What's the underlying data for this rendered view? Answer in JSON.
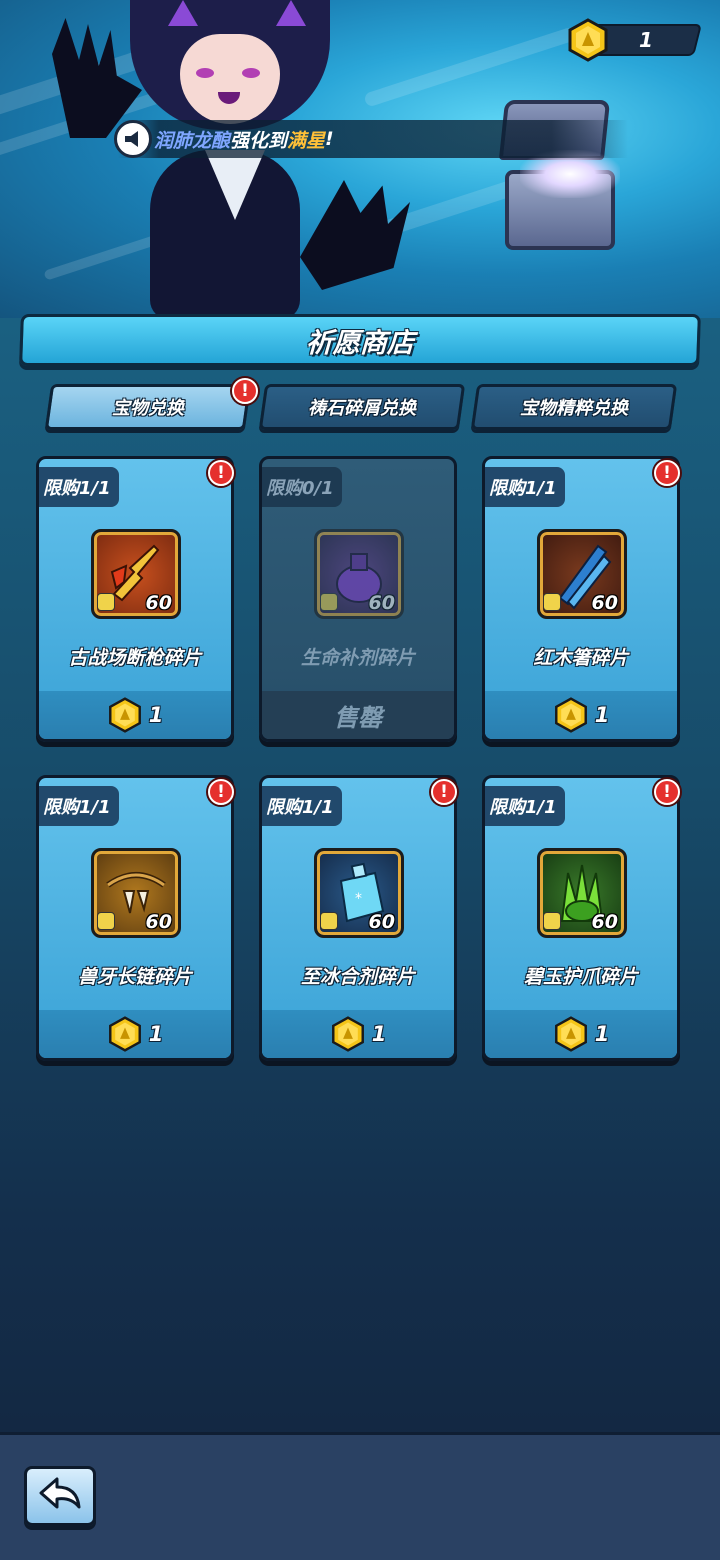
{
  "currency": {
    "amount": "1",
    "icon": "dice-coin-icon"
  },
  "announcement": {
    "part1": "润肺龙酿",
    "part2": "强化到",
    "part3": "满星",
    "part4": "!"
  },
  "title": "祈愿商店",
  "tabs": [
    {
      "label": "宝物兑换",
      "active": true,
      "alert": "!"
    },
    {
      "label": "祷石碎屑兑换",
      "active": false
    },
    {
      "label": "宝物精粹兑换",
      "active": false
    }
  ],
  "items": [
    {
      "limit": "限购1/1",
      "name": "古战场断枪碎片",
      "qty": "60",
      "price": "1",
      "icon": "broken-spear-icon",
      "alert": "!",
      "sold_out": false
    },
    {
      "limit": "限购0/1",
      "name": "生命补剂碎片",
      "qty": "60",
      "price": "",
      "sold_label": "售罄",
      "icon": "potion-icon",
      "sold_out": true
    },
    {
      "limit": "限购1/1",
      "name": "红木箸碎片",
      "qty": "60",
      "price": "1",
      "icon": "chopsticks-icon",
      "alert": "!",
      "sold_out": false
    },
    {
      "limit": "限购1/1",
      "name": "兽牙长链碎片",
      "qty": "60",
      "price": "1",
      "icon": "fang-chain-icon",
      "alert": "!",
      "sold_out": false
    },
    {
      "limit": "限购1/1",
      "name": "至冰合剂碎片",
      "qty": "60",
      "price": "1",
      "icon": "ice-flask-icon",
      "alert": "!",
      "sold_out": false
    },
    {
      "limit": "限购1/1",
      "name": "碧玉护爪碎片",
      "qty": "60",
      "price": "1",
      "icon": "jade-claw-icon",
      "alert": "!",
      "sold_out": false
    }
  ],
  "colors": {
    "accent": "#3aa2d6",
    "alert": "#e5302d",
    "gold": "#f5c518",
    "highlight": "#ffc038"
  }
}
